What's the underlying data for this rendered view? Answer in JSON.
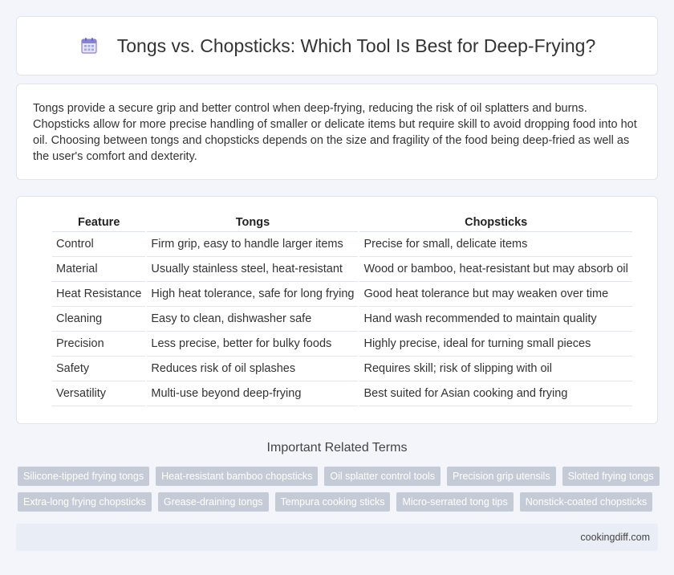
{
  "header": {
    "title": "Tongs vs. Chopsticks: Which Tool Is Best for Deep-Frying?",
    "icon": "calendar-icon"
  },
  "intro": {
    "text": "Tongs provide a secure grip and better control when deep-frying, reducing the risk of oil splatters and burns. Chopsticks allow for more precise handling of smaller or delicate items but require skill to avoid dropping food into hot oil. Choosing between tongs and chopsticks depends on the size and fragility of the food being deep-fried as well as the user's comfort and dexterity."
  },
  "table": {
    "headers": [
      "Feature",
      "Tongs",
      "Chopsticks"
    ],
    "rows": [
      [
        "Control",
        "Firm grip, easy to handle larger items",
        "Precise for small, delicate items"
      ],
      [
        "Material",
        "Usually stainless steel, heat-resistant",
        "Wood or bamboo, heat-resistant but may absorb oil"
      ],
      [
        "Heat Resistance",
        "High heat tolerance, safe for long frying",
        "Good heat tolerance but may weaken over time"
      ],
      [
        "Cleaning",
        "Easy to clean, dishwasher safe",
        "Hand wash recommended to maintain quality"
      ],
      [
        "Precision",
        "Less precise, better for bulky foods",
        "Highly precise, ideal for turning small pieces"
      ],
      [
        "Safety",
        "Reduces risk of oil splashes",
        "Requires skill; risk of slipping with oil"
      ],
      [
        "Versatility",
        "Multi-use beyond deep-frying",
        "Best suited for Asian cooking and frying"
      ]
    ]
  },
  "related": {
    "title": "Important Related Terms",
    "rows": [
      [
        "Silicone-tipped frying tongs",
        "Heat-resistant bamboo chopsticks",
        "Oil splatter control tools",
        "Precision grip utensils",
        "Slotted frying tongs"
      ],
      [
        "Extra-long frying chopsticks",
        "Grease-draining tongs",
        "Tempura cooking sticks",
        "Micro-serrated tong tips",
        "Nonstick-coated chopsticks"
      ]
    ]
  },
  "footer": {
    "site": "cookingdiff.com"
  }
}
